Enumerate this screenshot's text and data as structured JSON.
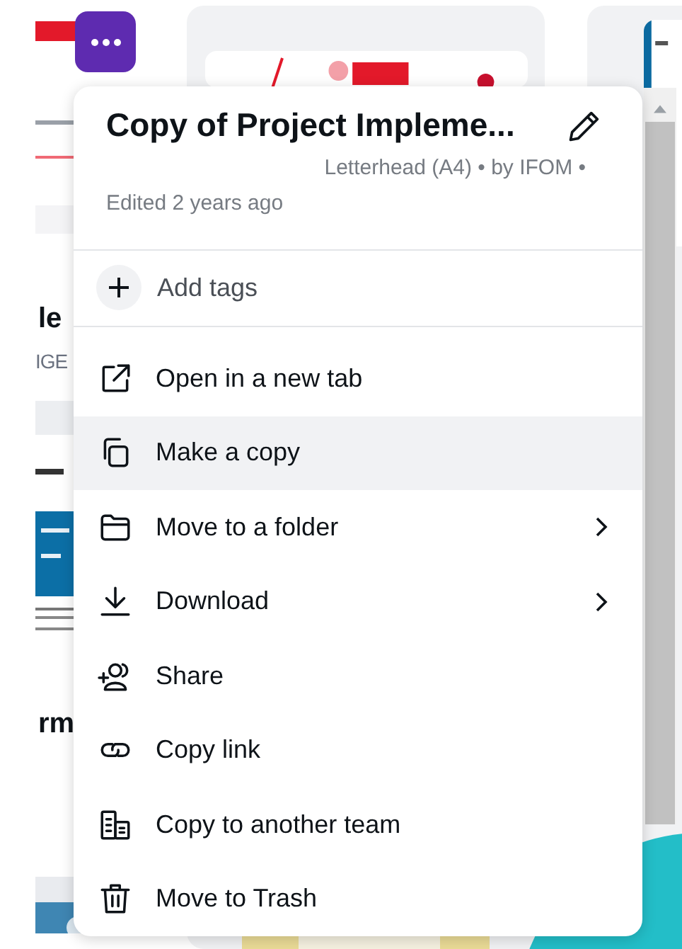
{
  "cards": [
    {
      "title": "le",
      "subtitle": "IGE"
    },
    {
      "title": "rm"
    }
  ],
  "menu": {
    "title": "Copy of Project Impleme...",
    "meta": "Letterhead (A4) • by IFOM •",
    "edited": "Edited 2 years ago",
    "add_tags": "Add tags",
    "items": [
      {
        "label": "Open in a new tab",
        "kind": "external",
        "submenu": false,
        "selected": false
      },
      {
        "label": "Make a copy",
        "kind": "copy",
        "submenu": false,
        "selected": true
      },
      {
        "label": "Move to a folder",
        "kind": "folder",
        "submenu": true,
        "selected": false
      },
      {
        "label": "Download",
        "kind": "download",
        "submenu": true,
        "selected": false
      },
      {
        "label": "Share",
        "kind": "share",
        "submenu": false,
        "selected": false
      },
      {
        "label": "Copy link",
        "kind": "link",
        "submenu": false,
        "selected": false
      },
      {
        "label": "Copy to another team",
        "kind": "team",
        "submenu": false,
        "selected": false
      },
      {
        "label": "Move to Trash",
        "kind": "trash",
        "submenu": false,
        "selected": false
      }
    ]
  }
}
